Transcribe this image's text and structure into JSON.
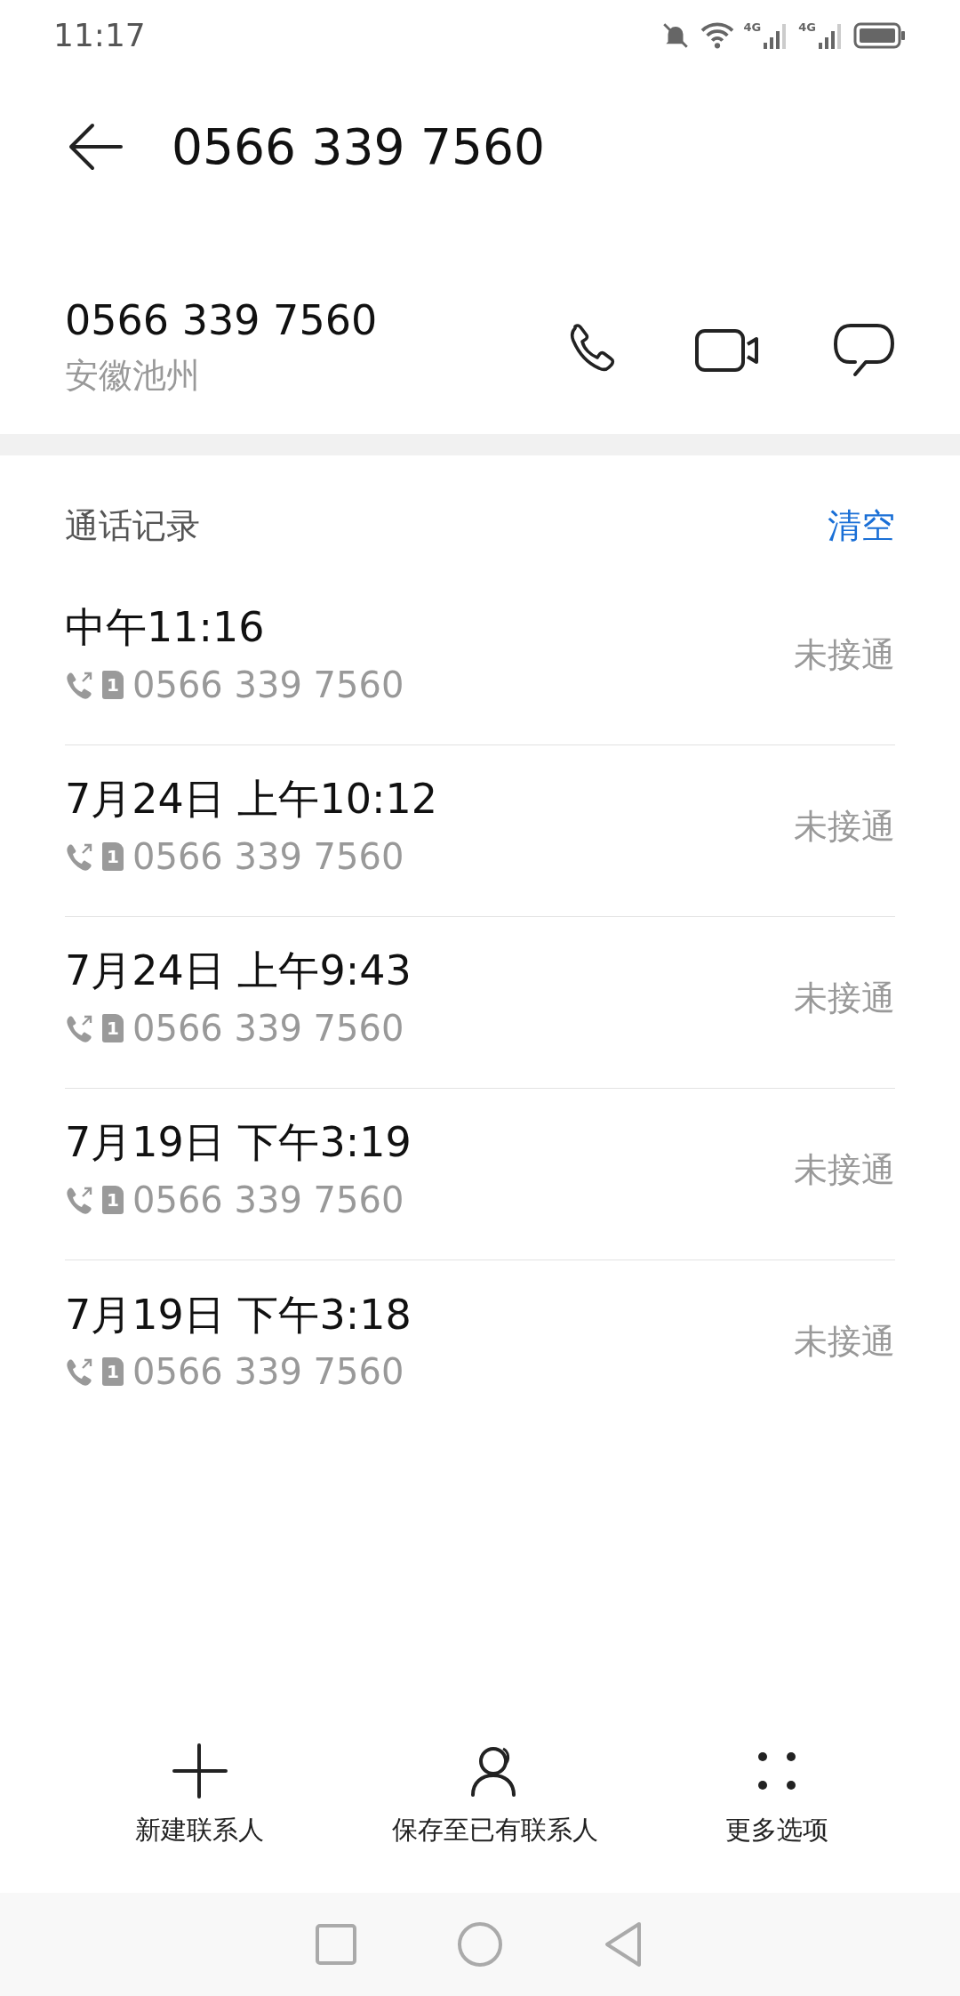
{
  "status_bar": {
    "time": "11:17",
    "network_1": "4G",
    "network_2": "4G"
  },
  "header": {
    "title": "0566 339 7560"
  },
  "contact": {
    "number": "0566 339 7560",
    "location": "安徽池州"
  },
  "call_log": {
    "title": "通话记录",
    "clear": "清空",
    "rows": [
      {
        "time": "中午11:16",
        "sim": "1",
        "number": "0566 339 7560",
        "status": "未接通"
      },
      {
        "time": "7月24日 上午10:12",
        "sim": "1",
        "number": "0566 339 7560",
        "status": "未接通"
      },
      {
        "time": "7月24日 上午9:43",
        "sim": "1",
        "number": "0566 339 7560",
        "status": "未接通"
      },
      {
        "time": "7月19日 下午3:19",
        "sim": "1",
        "number": "0566 339 7560",
        "status": "未接通"
      },
      {
        "time": "7月19日 下午3:18",
        "sim": "1",
        "number": "0566 339 7560",
        "status": "未接通"
      }
    ]
  },
  "actions": [
    {
      "kind": "add",
      "label": "新建联系人"
    },
    {
      "kind": "person",
      "label": "保存至已有联系人"
    },
    {
      "kind": "more",
      "label": "更多选项"
    }
  ]
}
